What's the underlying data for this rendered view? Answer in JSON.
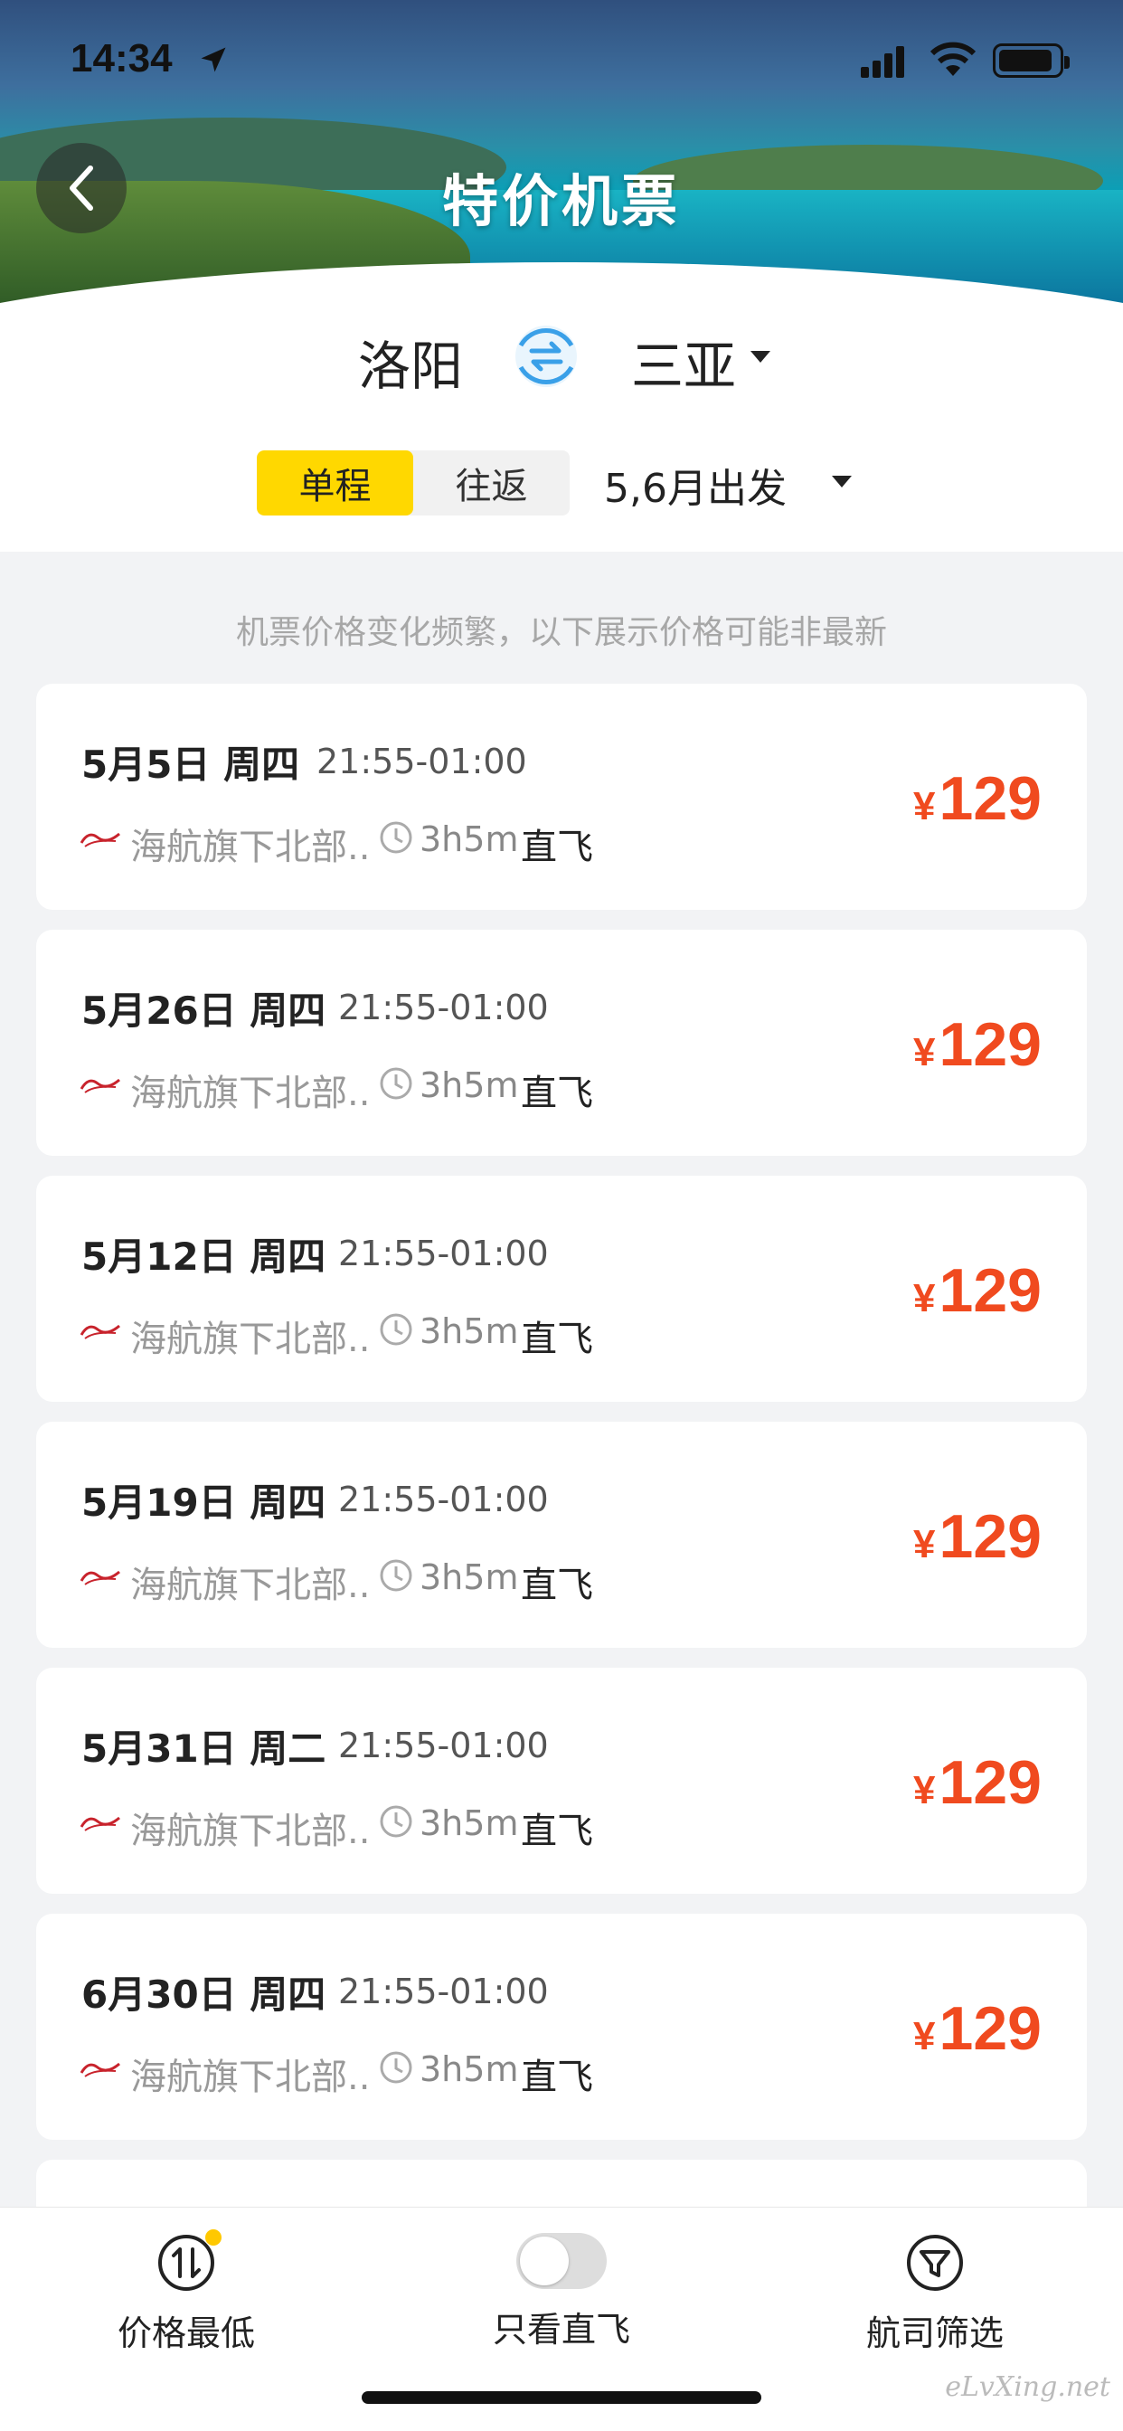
{
  "status_bar": {
    "time": "14:34"
  },
  "header": {
    "title": "特价机票"
  },
  "route": {
    "from": "洛阳",
    "to": "三亚"
  },
  "trip_type": {
    "one_way": "单程",
    "round_trip": "往返"
  },
  "date_filter": {
    "label": "5,6月出发"
  },
  "notice": "机票价格变化频繁，以下展示价格可能非最新",
  "flights": [
    {
      "date": "5月5日 周四",
      "time": "21:55-01:00",
      "airline": "海航旗下北部..",
      "duration": "3h5m",
      "direct": "直飞",
      "currency": "¥",
      "price": "129"
    },
    {
      "date": "5月26日 周四",
      "time": "21:55-01:00",
      "airline": "海航旗下北部..",
      "duration": "3h5m",
      "direct": "直飞",
      "currency": "¥",
      "price": "129"
    },
    {
      "date": "5月12日 周四",
      "time": "21:55-01:00",
      "airline": "海航旗下北部..",
      "duration": "3h5m",
      "direct": "直飞",
      "currency": "¥",
      "price": "129"
    },
    {
      "date": "5月19日 周四",
      "time": "21:55-01:00",
      "airline": "海航旗下北部..",
      "duration": "3h5m",
      "direct": "直飞",
      "currency": "¥",
      "price": "129"
    },
    {
      "date": "5月31日 周二",
      "time": "21:55-01:00",
      "airline": "海航旗下北部..",
      "duration": "3h5m",
      "direct": "直飞",
      "currency": "¥",
      "price": "129"
    },
    {
      "date": "6月30日 周四",
      "time": "21:55-01:00",
      "airline": "海航旗下北部..",
      "duration": "3h5m",
      "direct": "直飞",
      "currency": "¥",
      "price": "129"
    }
  ],
  "bottom_bar": {
    "price_sort": "价格最低",
    "direct_only": "只看直飞",
    "airline_filter": "航司筛选"
  },
  "watermark": "eLvXing.net",
  "colors": {
    "accent": "#ffd800",
    "price": "#f04a1f",
    "swap": "#3aa0e8"
  }
}
